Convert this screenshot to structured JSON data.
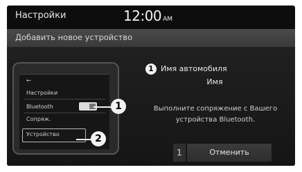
{
  "status_bar": {
    "title": "Настройки",
    "time": "12:00",
    "ampm": "AM"
  },
  "header": {
    "title": "Добавить новое устройство"
  },
  "phone": {
    "settings": "Настройки",
    "bluetooth": "Bluetooth",
    "other": "Сопряж.",
    "device": "Устройство"
  },
  "callouts": {
    "one": "1",
    "two": "2"
  },
  "info": {
    "car_label": "Имя автомобиля",
    "car_name": "Имя",
    "instruction": "Выполните сопряжение с Вашего устройства Bluetooth."
  },
  "pin": "1",
  "cancel_label": "Отменить"
}
